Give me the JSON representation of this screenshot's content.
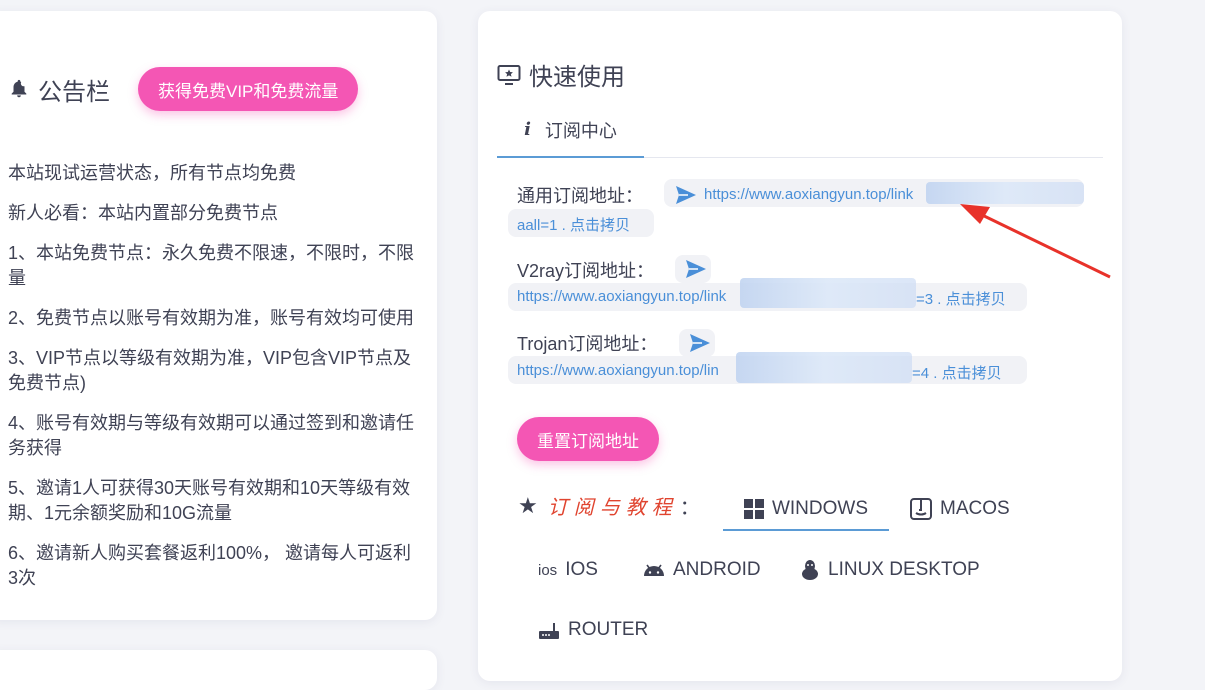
{
  "announcement": {
    "title": "公告栏",
    "vip_button": "获得免费VIP和免费流量",
    "items": [
      "本站现试运营状态，所有节点均免费",
      "新人必看：本站内置部分免费节点",
      "1、本站免费节点：永久免费不限速，不限时，不限量",
      "2、免费节点以账号有效期为准，账号有效均可使用",
      "3、VIP节点以等级有效期为准，VIP包含VIP节点及免费节点)",
      "4、账号有效期与等级有效期可以通过签到和邀请任务获得",
      "5、邀请1人可获得30天账号有效期和10天等级有效期、1元余额奖励和10G流量",
      "6、邀请新人购买套餐返利100%， 邀请每人可返利3次"
    ]
  },
  "quick_use": {
    "title": "快速使用",
    "tab_label": "订阅中心",
    "general": {
      "label": "通用订阅地址：",
      "url_start": "https://www.aoxiangyun.top/link",
      "url_end": "aall=1",
      "copy": " . 点击拷贝"
    },
    "v2ray": {
      "label": "V2ray订阅地址：",
      "url_start": "https://www.aoxiangyun.top/link",
      "url_end": "=3",
      "copy": " . 点击拷贝"
    },
    "trojan": {
      "label": "Trojan订阅地址：",
      "url_start": "https://www.aoxiangyun.top/lin",
      "url_end": "=4",
      "copy": " . 点击拷贝"
    },
    "reset_button": "重置订阅地址",
    "tutorial_label": "订阅与教程",
    "tutorial_colon": "：",
    "os_tabs": [
      "WINDOWS",
      "MACOS",
      "IOS",
      "ANDROID",
      "LINUX DESKTOP",
      "ROUTER"
    ],
    "ios_badge": "ios"
  },
  "colors": {
    "accent_pink": "#f456b4",
    "link_blue": "#4a8fd8",
    "tab_underline": "#5b9bd5",
    "annotation_arrow": "#e8322a"
  }
}
